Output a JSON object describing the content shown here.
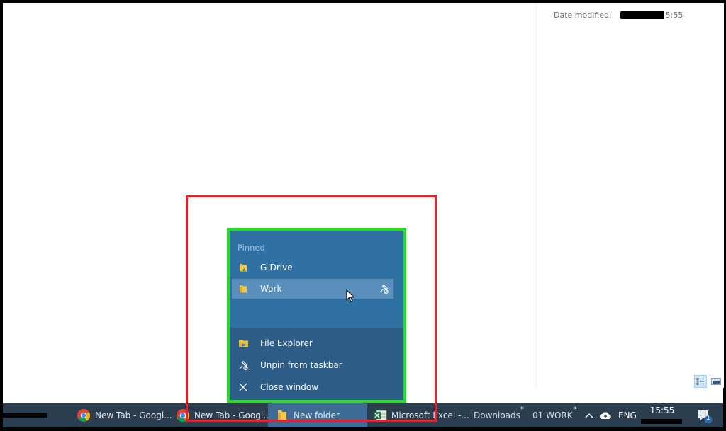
{
  "details_pane": {
    "date_modified_label": "Date modified:",
    "date_modified_time_suffix": "5:55",
    "view_buttons": [
      {
        "name": "details-view",
        "active": true
      },
      {
        "name": "large-icons-view",
        "active": false
      }
    ]
  },
  "jump_list": {
    "section_header": "Pinned",
    "pinned": [
      {
        "label": "G-Drive",
        "icon": "gdrive-folder-icon"
      },
      {
        "label": "Work",
        "icon": "folder-icon",
        "hovered": true,
        "action_icon": "unpin-icon"
      }
    ],
    "tasks": [
      {
        "label": "File Explorer",
        "icon": "file-explorer-icon"
      },
      {
        "label": "Unpin from taskbar",
        "icon": "unpin-icon"
      },
      {
        "label": "Close window",
        "icon": "close-icon"
      }
    ]
  },
  "taskbar": {
    "items": [
      {
        "label": "New Tab - Googl...",
        "icon": "chrome-icon"
      },
      {
        "label": "New Tab - Googl...",
        "icon": "chrome-icon"
      },
      {
        "label": "New folder",
        "icon": "folder-icon",
        "active": true
      },
      {
        "label": "Microsoft Excel -...",
        "icon": "excel-icon"
      }
    ],
    "toolbars": [
      {
        "label": "Downloads",
        "chevron": "»"
      },
      {
        "label": "01 WORK",
        "chevron": "»"
      }
    ],
    "tray": {
      "language": "ENG",
      "time": "15:55",
      "notification_count": "1"
    }
  },
  "annotations": {
    "red_box_color": "#ee1c24",
    "green_box_color": "#22dd22"
  }
}
